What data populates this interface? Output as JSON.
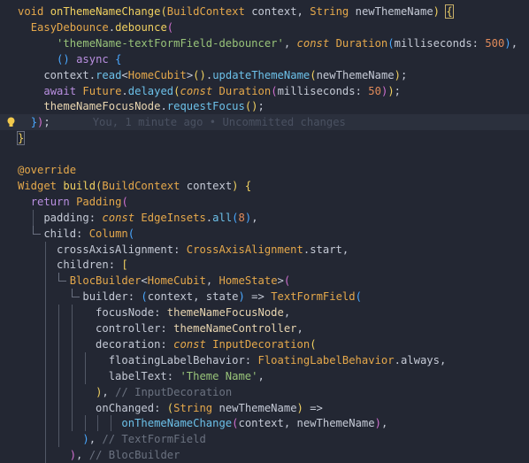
{
  "editor": {
    "blame_annotation": "You, 1 minute ago • Uncommitted changes",
    "lines": [
      [
        [
          "k",
          "void"
        ],
        [
          "p",
          " "
        ],
        [
          "fn",
          "onThemeNameChange"
        ],
        [
          "br1",
          "("
        ],
        [
          "t",
          "BuildContext"
        ],
        [
          "p",
          " context, "
        ],
        [
          "t",
          "String"
        ],
        [
          "p",
          " newThemeName"
        ],
        [
          "br1",
          ")"
        ],
        [
          "p",
          " "
        ],
        [
          "br1",
          "{"
        ]
      ],
      [
        [
          "p",
          "  "
        ],
        [
          "t",
          "EasyDebounce"
        ],
        [
          "p",
          "."
        ],
        [
          "fn",
          "debounce"
        ],
        [
          "br2",
          "("
        ]
      ],
      [
        [
          "p",
          "      "
        ],
        [
          "s",
          "'themeName-textFormField-debouncer'"
        ],
        [
          "p",
          ", "
        ],
        [
          "ki",
          "const"
        ],
        [
          "p",
          " "
        ],
        [
          "t",
          "Duration"
        ],
        [
          "br3",
          "("
        ],
        [
          "p",
          "milliseconds: "
        ],
        [
          "n",
          "500"
        ],
        [
          "br3",
          ")"
        ],
        [
          "p",
          ","
        ]
      ],
      [
        [
          "p",
          "      "
        ],
        [
          "br3",
          "()"
        ],
        [
          "p",
          " "
        ],
        [
          "kp",
          "async"
        ],
        [
          "p",
          " "
        ],
        [
          "br3",
          "{"
        ]
      ],
      [
        [
          "p",
          "    context."
        ],
        [
          "f",
          "read"
        ],
        [
          "p",
          "<"
        ],
        [
          "t",
          "HomeCubit"
        ],
        [
          "p",
          ">"
        ],
        [
          "br1",
          "()"
        ],
        [
          "p",
          "."
        ],
        [
          "f",
          "updateThemeName"
        ],
        [
          "br1",
          "("
        ],
        [
          "p",
          "newThemeName"
        ],
        [
          "br1",
          ")"
        ],
        [
          "p",
          ";"
        ]
      ],
      [
        [
          "p",
          "    "
        ],
        [
          "kp",
          "await"
        ],
        [
          "p",
          " "
        ],
        [
          "t",
          "Future"
        ],
        [
          "p",
          "."
        ],
        [
          "f",
          "delayed"
        ],
        [
          "br1",
          "("
        ],
        [
          "ki",
          "const"
        ],
        [
          "p",
          " "
        ],
        [
          "t",
          "Duration"
        ],
        [
          "br2",
          "("
        ],
        [
          "p",
          "milliseconds: "
        ],
        [
          "n",
          "50"
        ],
        [
          "br2",
          ")"
        ],
        [
          "br1",
          ")"
        ],
        [
          "p",
          ";"
        ]
      ],
      [
        [
          "p",
          "    "
        ],
        [
          "prop",
          "themeNameFocusNode"
        ],
        [
          "p",
          "."
        ],
        [
          "f",
          "requestFocus"
        ],
        [
          "br1",
          "()"
        ],
        [
          "p",
          ";"
        ]
      ],
      [
        [
          "p",
          "  "
        ],
        [
          "br3",
          "}"
        ],
        [
          "br2",
          ")"
        ],
        [
          "p",
          ";"
        ]
      ],
      [
        [
          "br1",
          "}"
        ]
      ],
      [],
      [
        [
          "an",
          "@override"
        ]
      ],
      [
        [
          "t",
          "Widget"
        ],
        [
          "p",
          " "
        ],
        [
          "fn",
          "build"
        ],
        [
          "br1",
          "("
        ],
        [
          "t",
          "BuildContext"
        ],
        [
          "p",
          " context"
        ],
        [
          "br1",
          ")"
        ],
        [
          "p",
          " "
        ],
        [
          "br1",
          "{"
        ]
      ],
      [
        [
          "p",
          "  "
        ],
        [
          "kp",
          "return"
        ],
        [
          "p",
          " "
        ],
        [
          "t",
          "Padding"
        ],
        [
          "br2",
          "("
        ]
      ],
      [
        [
          "p",
          "    padding: "
        ],
        [
          "ki",
          "const"
        ],
        [
          "p",
          " "
        ],
        [
          "t",
          "EdgeInsets"
        ],
        [
          "p",
          "."
        ],
        [
          "f",
          "all"
        ],
        [
          "br3",
          "("
        ],
        [
          "n",
          "8"
        ],
        [
          "br3",
          ")"
        ],
        [
          "p",
          ","
        ]
      ],
      [
        [
          "p",
          "    child: "
        ],
        [
          "t",
          "Column"
        ],
        [
          "br3",
          "("
        ]
      ],
      [
        [
          "p",
          "      crossAxisAlignment: "
        ],
        [
          "t",
          "CrossAxisAlignment"
        ],
        [
          "p",
          "."
        ],
        [
          "p",
          "start,"
        ]
      ],
      [
        [
          "p",
          "      children: "
        ],
        [
          "br1",
          "["
        ]
      ],
      [
        [
          "p",
          "        "
        ],
        [
          "t",
          "BlocBuilder"
        ],
        [
          "p",
          "<"
        ],
        [
          "t",
          "HomeCubit"
        ],
        [
          "p",
          ", "
        ],
        [
          "t",
          "HomeState"
        ],
        [
          "p",
          ">"
        ],
        [
          "br2",
          "("
        ]
      ],
      [
        [
          "p",
          "          builder: "
        ],
        [
          "br3",
          "("
        ],
        [
          "p",
          "context, state"
        ],
        [
          "br3",
          ")"
        ],
        [
          "p",
          " => "
        ],
        [
          "t",
          "TextFormField"
        ],
        [
          "br3",
          "("
        ]
      ],
      [
        [
          "p",
          "            focusNode: "
        ],
        [
          "prop",
          "themeNameFocusNode"
        ],
        [
          "p",
          ","
        ]
      ],
      [
        [
          "p",
          "            controller: "
        ],
        [
          "prop",
          "themeNameController"
        ],
        [
          "p",
          ","
        ]
      ],
      [
        [
          "p",
          "            decoration: "
        ],
        [
          "ki",
          "const"
        ],
        [
          "p",
          " "
        ],
        [
          "t",
          "InputDecoration"
        ],
        [
          "br1",
          "("
        ]
      ],
      [
        [
          "p",
          "              floatingLabelBehavior: "
        ],
        [
          "t",
          "FloatingLabelBehavior"
        ],
        [
          "p",
          "."
        ],
        [
          "p",
          "always,"
        ]
      ],
      [
        [
          "p",
          "              labelText: "
        ],
        [
          "s",
          "'Theme Name'"
        ],
        [
          "p",
          ","
        ]
      ],
      [
        [
          "p",
          "            "
        ],
        [
          "br1",
          ")"
        ],
        [
          "p",
          ", "
        ],
        [
          "c",
          "// InputDecoration"
        ]
      ],
      [
        [
          "p",
          "            onChanged: "
        ],
        [
          "br1",
          "("
        ],
        [
          "t",
          "String"
        ],
        [
          "p",
          " newThemeName"
        ],
        [
          "br1",
          ")"
        ],
        [
          "p",
          " =>"
        ]
      ],
      [
        [
          "p",
          "                "
        ],
        [
          "f",
          "onThemeNameChange"
        ],
        [
          "br2",
          "("
        ],
        [
          "p",
          "context, newThemeName"
        ],
        [
          "br2",
          ")"
        ],
        [
          "p",
          ","
        ]
      ],
      [
        [
          "p",
          "          "
        ],
        [
          "br3",
          ")"
        ],
        [
          "p",
          ", "
        ],
        [
          "c",
          "// TextFormField"
        ]
      ],
      [
        [
          "p",
          "        "
        ],
        [
          "br2",
          ")"
        ],
        [
          "p",
          ", "
        ],
        [
          "c",
          "// BlocBuilder"
        ]
      ]
    ]
  }
}
